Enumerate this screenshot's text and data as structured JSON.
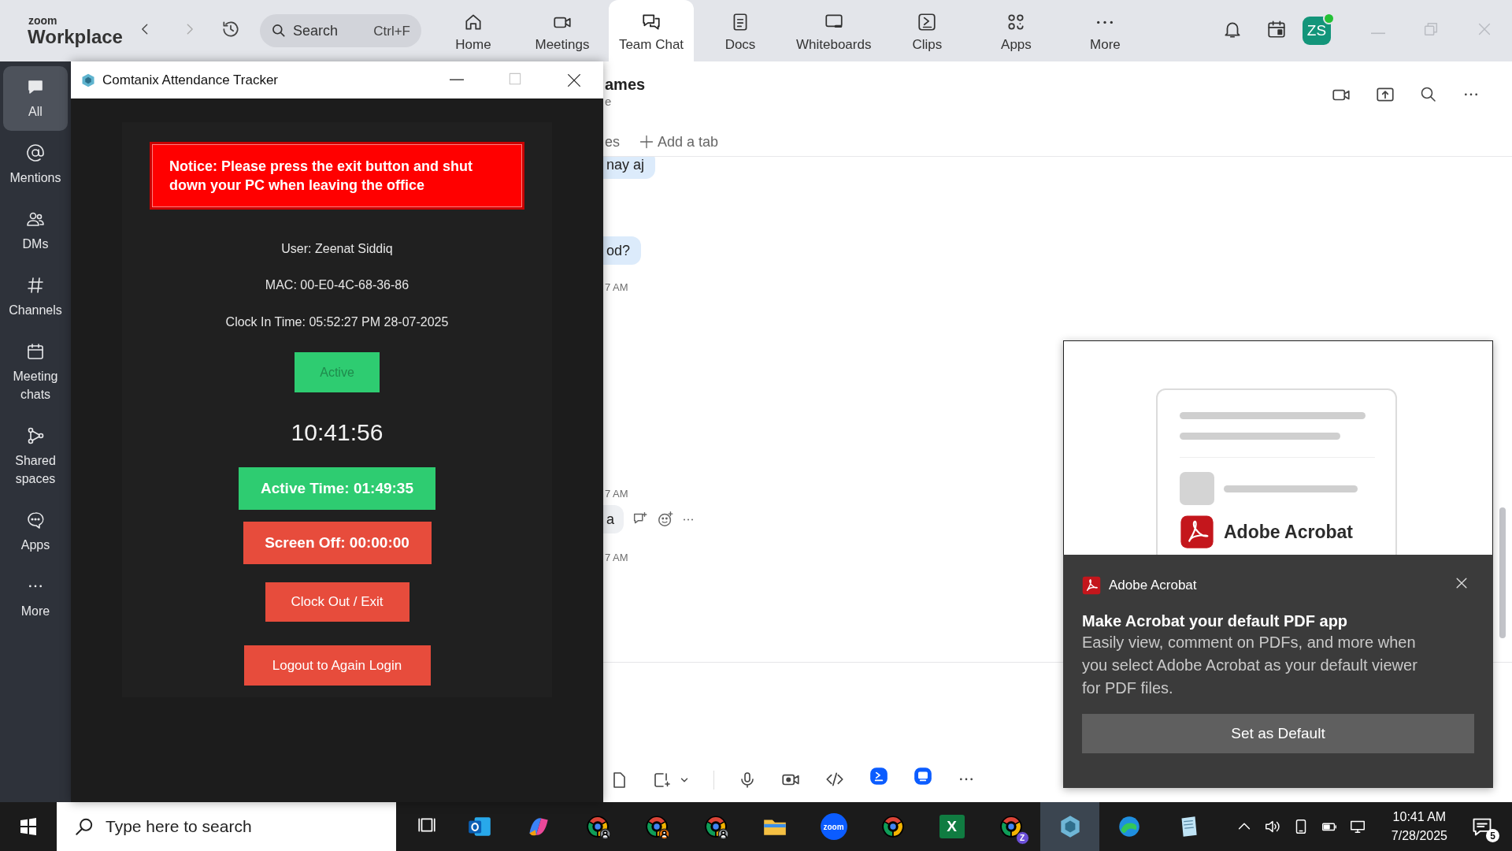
{
  "top_bar": {
    "logo_small": "zoom",
    "logo": "Workplace",
    "search": {
      "placeholder": "Search",
      "shortcut": "Ctrl+F"
    },
    "nav": [
      {
        "label": "Home",
        "selected": false
      },
      {
        "label": "Meetings",
        "selected": false
      },
      {
        "label": "Team Chat",
        "selected": true
      },
      {
        "label": "Docs",
        "selected": false
      },
      {
        "label": "Whiteboards",
        "selected": false
      },
      {
        "label": "Clips",
        "selected": false
      },
      {
        "label": "Apps",
        "selected": false
      },
      {
        "label": "More",
        "selected": false
      }
    ],
    "avatar": {
      "initials": "ZS",
      "online": true
    }
  },
  "sidebar": {
    "items": [
      {
        "label": "All",
        "selected": true
      },
      {
        "label": "Mentions",
        "selected": false
      },
      {
        "label": "DMs",
        "selected": false
      },
      {
        "label": "Channels",
        "selected": false
      },
      {
        "label": "Meeting chats",
        "selected": false
      },
      {
        "label": "Shared spaces",
        "selected": false
      },
      {
        "label": "Apps",
        "selected": false
      },
      {
        "label": "More",
        "selected": false
      }
    ]
  },
  "chat": {
    "title": "ames",
    "subtitle": "e",
    "tab": "es",
    "add_tab": "Add a tab",
    "messages": [
      {
        "kind": "bubble",
        "text": "nay aj",
        "hovered": false
      },
      {
        "kind": "bubble",
        "text": "od?",
        "hovered": false
      },
      {
        "kind": "time",
        "text": "7 AM"
      },
      {
        "kind": "time",
        "text": "7 AM"
      },
      {
        "kind": "bubble",
        "text": "a",
        "hovered": true
      },
      {
        "kind": "time",
        "text": "7 AM"
      }
    ]
  },
  "attendance_window": {
    "title": "Comtanix Attendance Tracker",
    "notice": "Notice: Please press the exit button and shut down your PC when leaving the office",
    "user": "User: Zeenat Siddiq",
    "mac": "MAC: 00-E0-4C-68-36-86",
    "clock_in": "Clock In Time: 05:52:27 PM 28-07-2025",
    "status": "Active",
    "clock": "10:41:56",
    "active_time": "Active Time: 01:49:35",
    "screen_off": "Screen Off: 00:00:00",
    "buttons": [
      "Clock Out / Exit",
      "Logout to Again Login"
    ]
  },
  "toast": {
    "illustration_label": "Adobe Acrobat",
    "app": "Adobe Acrobat",
    "title": "Make Acrobat your default PDF app",
    "body": "Easily view, comment on PDFs, and more when you select Adobe Acrobat as your default viewer for PDF files.",
    "button": "Set as Default"
  },
  "taskbar": {
    "search": {
      "placeholder": "Type here to search"
    },
    "apps": [
      {
        "selected": false
      },
      {
        "selected": false
      },
      {
        "selected": false
      },
      {
        "selected": false
      },
      {
        "selected": false
      },
      {
        "selected": false
      },
      {
        "selected": false,
        "text": "zoom"
      },
      {
        "selected": false
      },
      {
        "selected": false,
        "text": "X"
      },
      {
        "selected": false,
        "text": "Z"
      },
      {
        "selected": true
      },
      {
        "selected": false
      },
      {
        "selected": false
      }
    ],
    "time": "10:41 AM",
    "date": "7/28/2025",
    "notifications": "5"
  }
}
